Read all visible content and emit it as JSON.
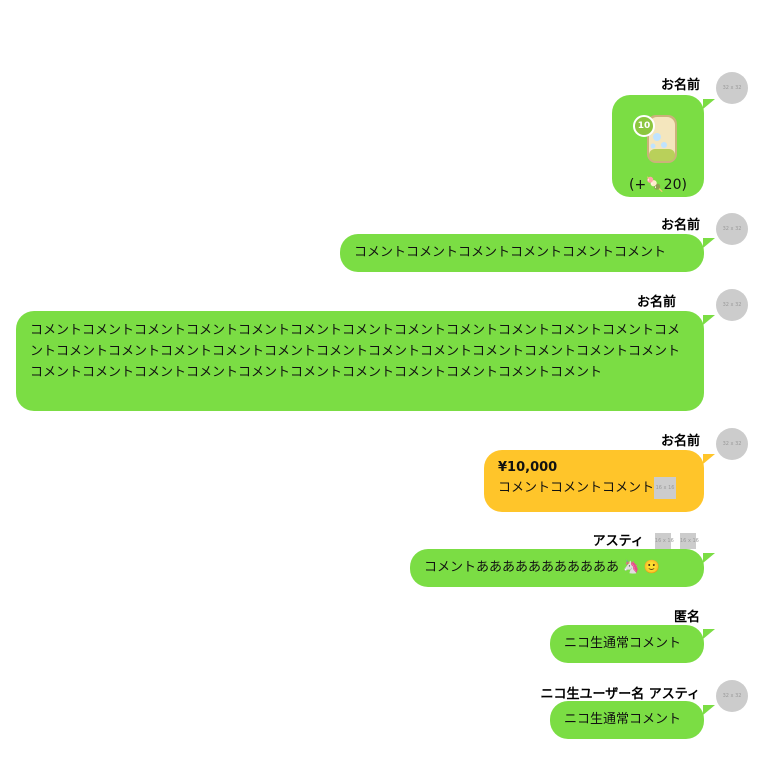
{
  "avatar_label": "32 x 32",
  "tiny_label": "16 x 16",
  "messages": [
    {
      "name": "お名前",
      "gift_count": "10",
      "gift_points": "(+🍡20)"
    },
    {
      "name": "お名前",
      "text": "コメントコメントコメントコメントコメントコメント"
    },
    {
      "name": "お名前",
      "text": "コメントコメントコメントコメントコメントコメントコメントコメントコメントコメントコメントコメントコメントコメントコメントコメントコメントコメントコメントコメントコメントコメントコメントコメントコメントコメントコメントコメントコメントコメントコメントコメントコメントコメントコメントコメント"
    },
    {
      "name": "お名前",
      "amount": "¥10,000",
      "text": "コメントコメントコメント"
    },
    {
      "name": "アスティ",
      "text": "コメントあああああああああああ",
      "emoji1": "🦄",
      "emoji2": "🙂"
    },
    {
      "name": "匿名",
      "text": "ニコ生通常コメント"
    },
    {
      "name": "ニコ生ユーザー名 アスティ",
      "text": "ニコ生通常コメント"
    }
  ],
  "colors": {
    "bubble_green": "#7bdd44",
    "bubble_gold": "#ffc52a",
    "avatar_gray": "#cccccc"
  }
}
